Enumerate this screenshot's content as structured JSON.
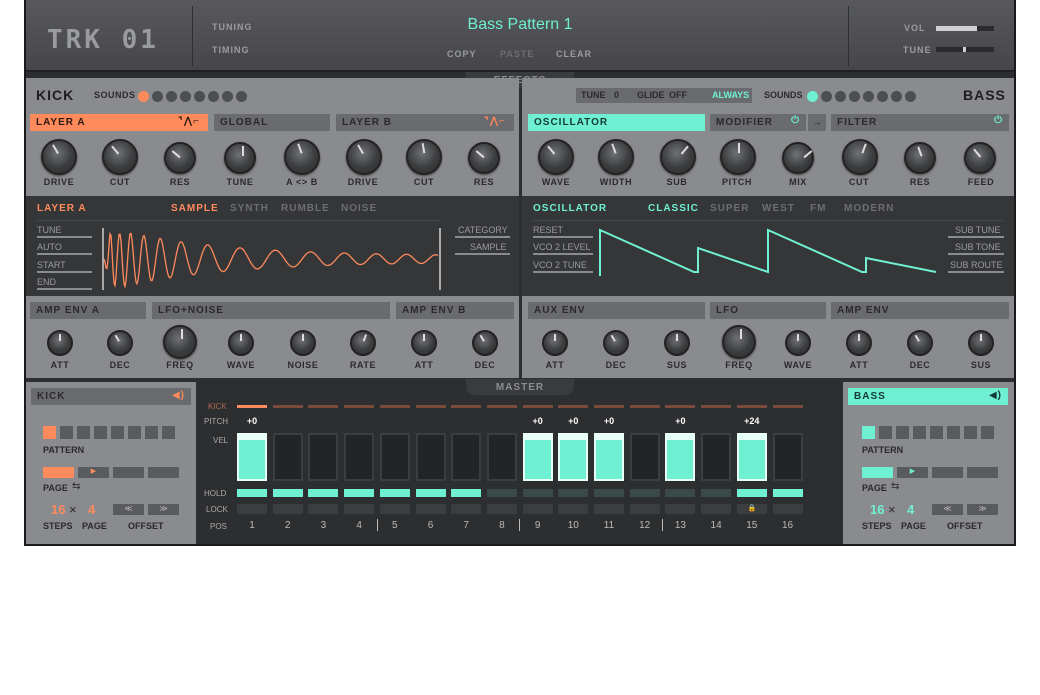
{
  "brand": "TRK 01",
  "header": {
    "tuning": "TUNING",
    "timing": "TIMING",
    "preset": "Bass Pattern 1",
    "copy": "COPY",
    "paste": "PASTE",
    "clear": "CLEAR",
    "vol": "VOL",
    "tune": "TUNE",
    "vol_level": 0.75,
    "tune_level": 0.5
  },
  "effects_label": "EFFECTS",
  "master_label": "MASTER",
  "kick": {
    "title": "KICK",
    "sounds": "SOUNDS",
    "layer_a": "LAYER A",
    "global": "GLOBAL",
    "layer_b": "LAYER B",
    "knobs_a": [
      "DRIVE",
      "CUT",
      "RES"
    ],
    "knobs_g": [
      "TUNE",
      "A <> B"
    ],
    "knobs_b": [
      "DRIVE",
      "CUT",
      "RES"
    ],
    "sample_title": "LAYER A",
    "modes": [
      "SAMPLE",
      "SYNTH",
      "RUMBLE",
      "NOISE"
    ],
    "left_params": [
      "TUNE",
      "AUTO",
      "START",
      "END"
    ],
    "right_params": [
      "CATEGORY",
      "SAMPLE"
    ],
    "amp_a": "AMP ENV A",
    "lfo": "LFO+NOISE",
    "amp_b": "AMP ENV B",
    "bottom_knobs": [
      "ATT",
      "DEC",
      "FREQ",
      "WAVE",
      "NOISE",
      "RATE",
      "ATT",
      "DEC"
    ]
  },
  "bass": {
    "title": "BASS",
    "tune": "TUNE",
    "tune_val": "0",
    "glide": "GLIDE",
    "glide_val": "OFF",
    "always": "ALWAYS",
    "sounds": "SOUNDS",
    "osc": "OSCILLATOR",
    "mod": "MODIFIER",
    "filter": "FILTER",
    "top_knobs": [
      "WAVE",
      "WIDTH",
      "SUB",
      "PITCH",
      "MIX",
      "CUT",
      "RES",
      "FEED"
    ],
    "osc_title": "OSCILLATOR",
    "modes": [
      "CLASSIC",
      "SUPER",
      "WEST",
      "FM",
      "MODERN"
    ],
    "left_params": [
      "RESET",
      "VCO 2 LEVEL",
      "VCO 2 TUNE"
    ],
    "right_params": [
      "SUB TUNE",
      "SUB TONE",
      "SUB ROUTE"
    ],
    "aux": "AUX ENV",
    "lfo": "LFO",
    "amp": "AMP ENV",
    "bottom_knobs": [
      "ATT",
      "DEC",
      "SUS",
      "FREQ",
      "WAVE",
      "ATT",
      "DEC",
      "SUS"
    ]
  },
  "seq": {
    "kick_label": "KICK",
    "pitch_label": "PITCH",
    "vel_label": "VEL",
    "hold_label": "HOLD",
    "lock_label": "LOCK",
    "pos_label": "POS",
    "pitch": [
      "+0",
      "",
      "",
      "",
      "",
      "",
      "",
      "",
      "+0",
      "+0",
      "+0",
      "",
      "+0",
      "",
      "+24",
      ""
    ],
    "vel": [
      1,
      0,
      0,
      0,
      0,
      0,
      0,
      0,
      1,
      1,
      1,
      0,
      1,
      0,
      1,
      0
    ],
    "hold": [
      1,
      1,
      1,
      1,
      1,
      1,
      1,
      0,
      0,
      0,
      0,
      0,
      0,
      0,
      1,
      1
    ],
    "positions": [
      "1",
      "2",
      "3",
      "4",
      "5",
      "6",
      "7",
      "8",
      "9",
      "10",
      "11",
      "12",
      "13",
      "14",
      "15",
      "16"
    ]
  },
  "left_panel": {
    "title": "KICK",
    "pattern": "PATTERN",
    "page": "PAGE",
    "steps_val": "16",
    "page_val": "4",
    "steps": "STEPS",
    "page_lbl": "PAGE",
    "offset": "OFFSET"
  },
  "right_panel": {
    "title": "BASS",
    "pattern": "PATTERN",
    "page": "PAGE",
    "steps_val": "16",
    "page_val": "4",
    "steps": "STEPS",
    "page_lbl": "PAGE",
    "offset": "OFFSET"
  },
  "colors": {
    "kick": "#ff8a5c",
    "bass": "#6ff0d2"
  }
}
